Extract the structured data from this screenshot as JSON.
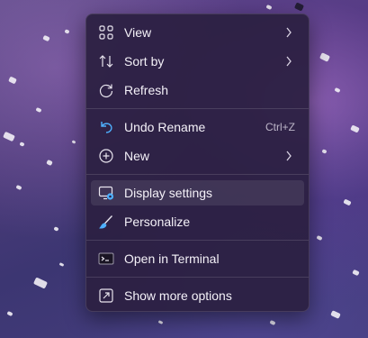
{
  "context_menu": {
    "items": [
      {
        "label": "View",
        "icon": "grid-icon",
        "has_submenu": true
      },
      {
        "label": "Sort by",
        "icon": "sort-arrows-icon",
        "has_submenu": true
      },
      {
        "label": "Refresh",
        "icon": "refresh-icon",
        "has_submenu": false
      },
      {
        "label": "Undo Rename",
        "icon": "undo-icon",
        "shortcut": "Ctrl+Z"
      },
      {
        "label": "New",
        "icon": "add-circle-icon",
        "has_submenu": true
      },
      {
        "label": "Display settings",
        "icon": "display-settings-icon",
        "highlighted": true
      },
      {
        "label": "Personalize",
        "icon": "brush-icon"
      },
      {
        "label": "Open in Terminal",
        "icon": "terminal-icon"
      },
      {
        "label": "Show more options",
        "icon": "show-more-icon"
      }
    ]
  },
  "colors": {
    "menu_background": "#2c2042",
    "text": "#f4f1f8",
    "icon_accent": "#4fb0ff"
  }
}
